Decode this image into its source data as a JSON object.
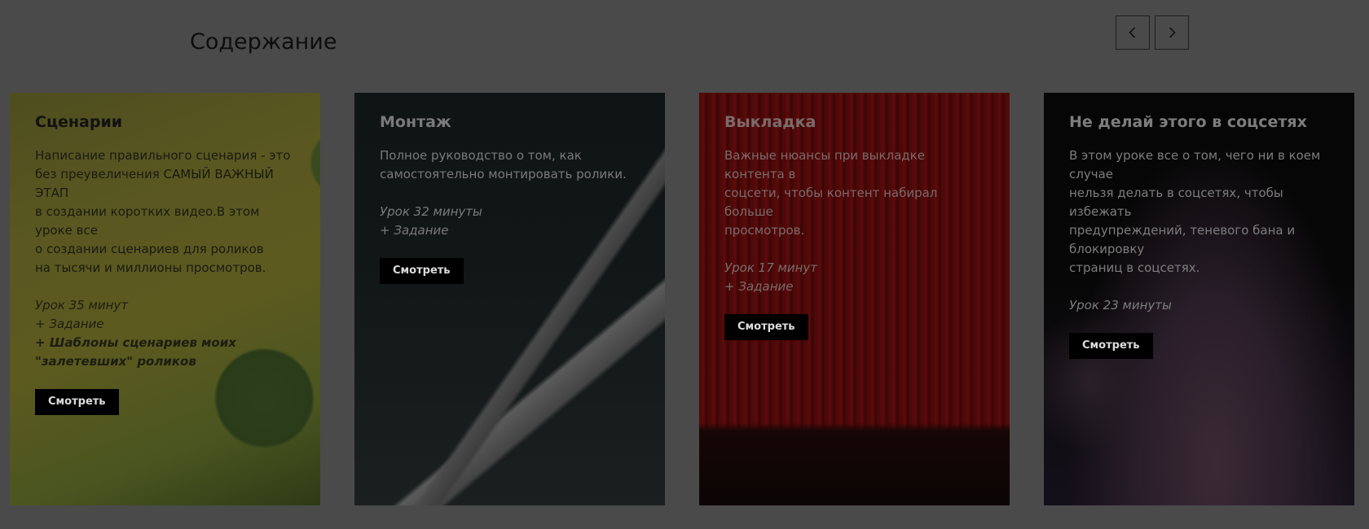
{
  "section": {
    "title": "Содержание"
  },
  "nav": {
    "prev_icon": "chevron-left-icon",
    "next_icon": "chevron-right-icon"
  },
  "cards": [
    {
      "title": "Сценарии",
      "desc_lines": [
        "Написание правильного сценария - это",
        "без преувеличения САМЫЙ ВАЖНЫЙ ЭТАП",
        "в создании коротких видео.В этом уроке все",
        "о создании сценариев для роликов",
        "на тысячи и миллионы просмотров."
      ],
      "meta_lines": [
        "Урок 35 минут",
        "+ Задание"
      ],
      "meta_bold": "+ Шаблоны сценариев моих \"залетевших\" роликов",
      "button": "Смотреть"
    },
    {
      "title": "Монтаж",
      "desc_lines": [
        "Полное руководство о том, как",
        "самостоятельно монтировать ролики."
      ],
      "meta_lines": [
        "Урок 32 минуты",
        "+ Задание"
      ],
      "button": "Смотреть"
    },
    {
      "title": "Выкладка",
      "desc_lines": [
        "Важные нюансы при выкладке контента в",
        "соцсети, чтобы контент набирал больше",
        "просмотров."
      ],
      "meta_lines": [
        "Урок 17 минут",
        "+ Задание"
      ],
      "button": "Смотреть"
    },
    {
      "title": "Не делай этого в соцсетях",
      "desc_lines": [
        "В этом уроке все о том, чего ни в коем случае",
        "нельзя делать в соцсетях, чтобы избежать",
        "предупреждений, теневого бана и блокировку",
        "страниц в соцсетях."
      ],
      "meta_lines": [
        "Урок 23 минуты"
      ],
      "button": "Смотреть"
    }
  ]
}
